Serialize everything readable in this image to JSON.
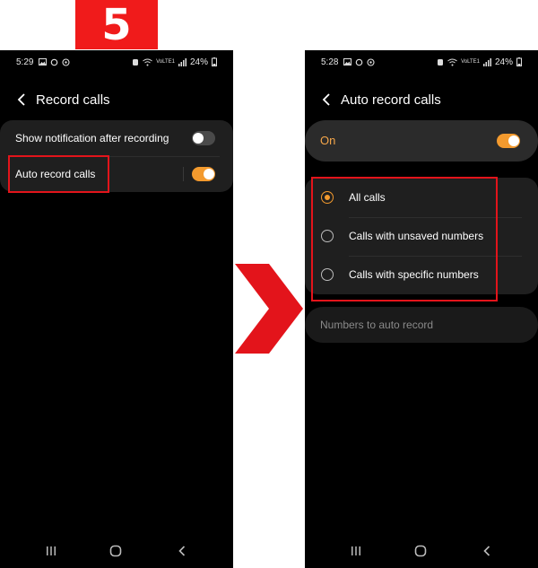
{
  "step_number": "5",
  "colors": {
    "accent": "#f39a2e",
    "highlight": "#e3141b",
    "background": "#000000",
    "card": "#1f1f1f"
  },
  "left_screen": {
    "status": {
      "time": "5:29",
      "battery": "24%",
      "network": "VoLTE1"
    },
    "title": "Record calls",
    "rows": [
      {
        "label": "Show notification after recording",
        "toggle": "off"
      },
      {
        "label": "Auto record calls",
        "toggle": "on"
      }
    ]
  },
  "right_screen": {
    "status": {
      "time": "5:28",
      "battery": "24%",
      "network": "VoLTE1"
    },
    "title": "Auto record calls",
    "master_toggle": {
      "label": "On",
      "state": "on"
    },
    "options": [
      {
        "label": "All calls",
        "selected": true
      },
      {
        "label": "Calls with unsaved numbers",
        "selected": false
      },
      {
        "label": "Calls with specific numbers",
        "selected": false
      }
    ],
    "numbers_item": {
      "label": "Numbers to auto record"
    }
  },
  "icons": [
    "back-icon",
    "gallery-icon",
    "sync-icon",
    "whatsapp-icon",
    "wifi-icon",
    "signal-icon",
    "battery-icon",
    "recent-apps-icon",
    "home-icon",
    "nav-back-icon",
    "chevron-right-arrow-icon"
  ]
}
